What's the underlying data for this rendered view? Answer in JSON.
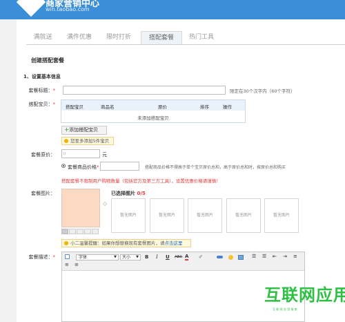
{
  "header": {
    "title": "商家营销中心",
    "url": "win.taobao.com"
  },
  "tabs": [
    "满就送",
    "满件优惠",
    "限时打折",
    "搭配套餐",
    "热门工具"
  ],
  "page_title": "创建搭配套餐",
  "section1_title": "1、设置基本信息",
  "name_field": {
    "label": "套餐标题：",
    "required_mark": "*",
    "hint": "限定在30个汉字内（60个字符）",
    "value": ""
  },
  "items": {
    "label": "搭配宝贝：",
    "required_mark": "*",
    "headers": [
      "搭配宝贝",
      "商品名",
      "原价",
      "排序",
      "操作"
    ],
    "empty_text": "未添加搭配宝贝",
    "add_button": "添加搭配宝贝",
    "tip": "您至多添加5件宝贝"
  },
  "price": {
    "label": "套餐原价：",
    "value": "0",
    "unit": "元",
    "radio_label": "套餐商品价格",
    "required_mark": "*",
    "hint": "搭配商品价格不得高于单个宝贝原价总和，高于原价总和时，按原价总和购买",
    "warning": "搭配套餐不限制用户购物数量（包括官方及第三方工具），设置优惠价格请谨慎！"
  },
  "images": {
    "label": "套餐图片：",
    "selected_label": "已选择图片",
    "count": "0",
    "max": "/5",
    "placeholder": "暂无图片",
    "tip_prefix": "小二温馨提醒：如果你想替换现有套餐图片，请",
    "tip_link": "点击这里"
  },
  "description": {
    "label": "套餐描述：",
    "required_mark": "*",
    "font_select": "字体",
    "size_select": "大小",
    "bold": "B",
    "italic": "I",
    "underline": "U",
    "strike": "ABC"
  },
  "watermark": {
    "text": "互联网应用",
    "sub": "互 联 网 应 用 指 南"
  },
  "colors": {
    "header_bg": "#3a8fd8",
    "accent_red": "#e4393c",
    "tip_bg": "#fff9e0",
    "image_bg": "#fbd9c2",
    "watermark_green": "#2fbf44"
  }
}
